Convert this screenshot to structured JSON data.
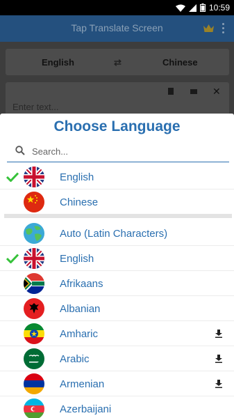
{
  "status_bar": {
    "time": "10:59"
  },
  "app_bar": {
    "title": "Tap Translate Screen",
    "crown_icon": "crown-icon",
    "menu_icon": "more-vert-icon"
  },
  "language_bar": {
    "source": "English",
    "target": "Chinese",
    "swap_icon": "swap-icon"
  },
  "input_card": {
    "placeholder": "Enter text...",
    "icons": [
      "paste-icon",
      "keyboard-icon",
      "close-icon"
    ]
  },
  "dialog": {
    "title": "Choose Language",
    "search_placeholder": "Search...",
    "recent": [
      {
        "name": "English",
        "selected": true,
        "flag": "uk-flag-icon"
      },
      {
        "name": "Chinese",
        "selected": false,
        "flag": "china-flag-icon"
      }
    ],
    "all": [
      {
        "name": "Auto (Latin Characters)",
        "selected": false,
        "download": false,
        "flag": "globe-icon"
      },
      {
        "name": "English",
        "selected": true,
        "download": false,
        "flag": "uk-flag-icon"
      },
      {
        "name": "Afrikaans",
        "selected": false,
        "download": false,
        "flag": "south-africa-flag-icon"
      },
      {
        "name": "Albanian",
        "selected": false,
        "download": false,
        "flag": "albania-flag-icon"
      },
      {
        "name": "Amharic",
        "selected": false,
        "download": true,
        "flag": "ethiopia-flag-icon"
      },
      {
        "name": "Arabic",
        "selected": false,
        "download": true,
        "flag": "saudi-arabia-flag-icon"
      },
      {
        "name": "Armenian",
        "selected": false,
        "download": true,
        "flag": "armenia-flag-icon"
      },
      {
        "name": "Azerbaijani",
        "selected": false,
        "download": false,
        "flag": "azerbaijan-flag-icon"
      }
    ]
  },
  "colors": {
    "accent": "#2a6fb0",
    "check": "#36c23a",
    "appbar": "#24507e"
  }
}
